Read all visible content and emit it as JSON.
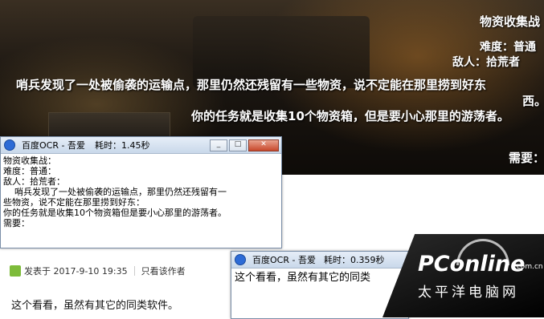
{
  "game": {
    "title": "物资收集战",
    "difficulty": "难度：普通",
    "enemy": "敌人：拾荒者",
    "desc_line1": "哨兵发现了一处被偷袭的运输点，那里仍然还残留有一些物资，说不定能在那里捞到好东",
    "desc_line1b": "西。",
    "desc_line2": "你的任务就是收集10个物资箱，但是要小心那里的游荡者。",
    "need": "需要："
  },
  "ocr_window_1": {
    "title": "百度OCR - 吾爱",
    "time": "耗时：1.45秒",
    "text": "物资收集战：\n难度：普通：\n敌人：拾荒者：\n    哨兵发现了一处被偷袭的运输点，那里仍然还残留有一\n些物资，说不定能在那里捞到好东：\n你的任务就是收集10个物资箱但是要小心那里的游荡者。\n需要："
  },
  "ocr_window_2": {
    "title": "百度OCR - 吾爱",
    "time": "耗时：0.359秒",
    "text": "这个看看，虽然有其它的同类"
  },
  "post": {
    "posted": "发表于 2017-9-10 19:35",
    "only_author": "只看该作者",
    "body": "这个看看，虽然有其它的同类软件。"
  },
  "logo": {
    "brand": "PConline",
    "suffix": ".com.cn",
    "chinese": "太平洋电脑网"
  },
  "window_buttons": {
    "min": "_",
    "max": "□",
    "close": "✕"
  }
}
